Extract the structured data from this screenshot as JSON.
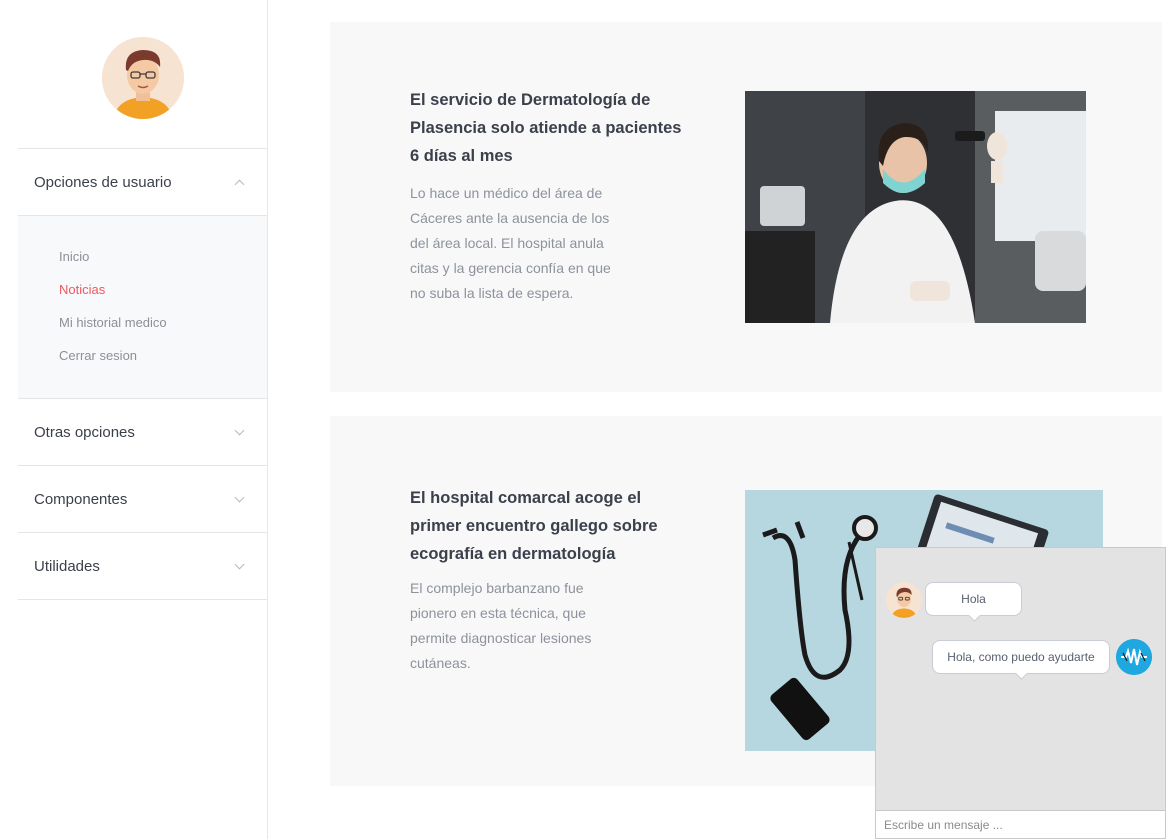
{
  "sidebar": {
    "sections": [
      {
        "label": "Opciones de usuario",
        "expanded": true,
        "items": [
          {
            "label": "Inicio",
            "active": false
          },
          {
            "label": "Noticias",
            "active": true
          },
          {
            "label": "Mi historial medico",
            "active": false
          },
          {
            "label": "Cerrar sesion",
            "active": false
          }
        ]
      },
      {
        "label": "Otras opciones",
        "expanded": false
      },
      {
        "label": "Componentes",
        "expanded": false
      },
      {
        "label": "Utilidades",
        "expanded": false
      }
    ]
  },
  "news": [
    {
      "title": "El servicio de Dermatología de Plasencia solo atiende a pacientes 6 días al mes",
      "text": "Lo hace un médico del área de Cáceres ante la ausencia de los del área local. El hospital anula citas y la gerencia confía en que no suba la lista de espera."
    },
    {
      "title": "El hospital comarcal acoge el primer encuentro gallego sobre ecografía en dermatología",
      "text": "El complejo barbanzano fue pionero en esta técnica, que permite diagnosticar lesiones cutáneas."
    }
  ],
  "chat": {
    "messages": [
      {
        "from": "user",
        "text": "Hola"
      },
      {
        "from": "bot",
        "text": "Hola, como puedo ayudarte"
      }
    ],
    "input_placeholder": "Escribe un mensaje ...",
    "input_value": ""
  },
  "colors": {
    "accent": "#f0585e",
    "card_bg": "#f8f8f9",
    "chat_bg": "#e3e3e3",
    "bot_avatar": "#1fa7e0"
  }
}
